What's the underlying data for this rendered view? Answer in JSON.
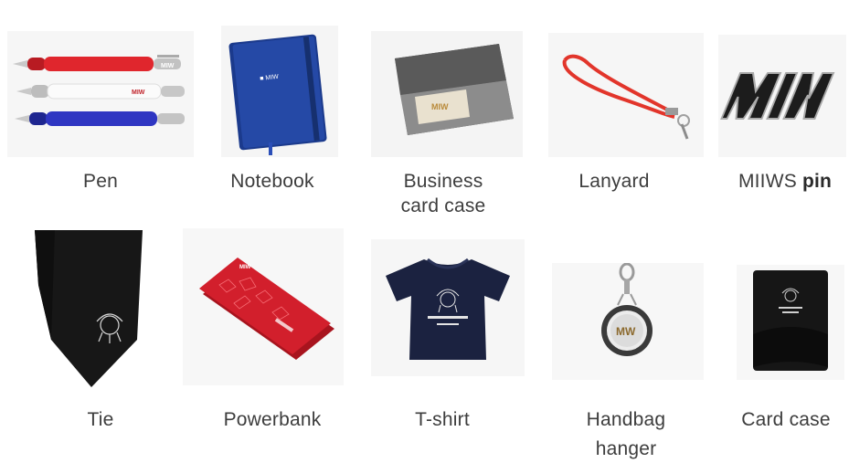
{
  "items": [
    {
      "label": "Pen"
    },
    {
      "label": "Notebook"
    },
    {
      "label_line1": "Business",
      "label_line2": "card case"
    },
    {
      "label": "Lanyard"
    },
    {
      "label_prefix": "MIIWS ",
      "label_bold": "pin"
    },
    {
      "label": "Tie"
    },
    {
      "label": "Powerbank"
    },
    {
      "label": "T-shirt"
    },
    {
      "label_line1": "Handbag",
      "label_line2": "hanger"
    },
    {
      "label": "Card case"
    }
  ],
  "colors": {
    "pen_red": "#d8232a",
    "pen_blue": "#2a2fb0",
    "notebook_blue": "#1d3f94",
    "lanyard_red": "#e2352b",
    "powerbank_red": "#d21f2c",
    "navy": "#1b2240",
    "black": "#161616"
  },
  "icons": [
    "pen-photo",
    "notebook-photo",
    "business-card-case-photo",
    "lanyard-photo",
    "pin-photo",
    "tie-photo",
    "powerbank-photo",
    "tshirt-photo",
    "handbag-hanger-photo",
    "card-case-photo"
  ]
}
